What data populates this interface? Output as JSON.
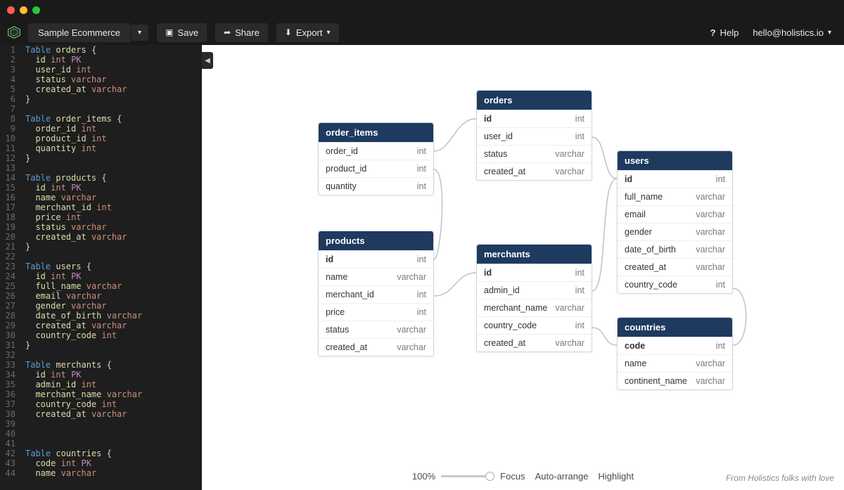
{
  "project": {
    "name": "Sample Ecommerce"
  },
  "toolbar": {
    "save": "Save",
    "share": "Share",
    "export": "Export",
    "help": "Help",
    "user": "hello@holistics.io"
  },
  "editor_lines": [
    {
      "n": 1,
      "tokens": [
        [
          "kw",
          "Table"
        ],
        [
          "sp",
          " "
        ],
        [
          "id",
          "orders"
        ],
        [
          "sp",
          " "
        ],
        [
          "br",
          "{"
        ]
      ]
    },
    {
      "n": 2,
      "tokens": [
        [
          "sp",
          "  "
        ],
        [
          "id",
          "id"
        ],
        [
          "sp",
          " "
        ],
        [
          "ty",
          "int"
        ],
        [
          "sp",
          " "
        ],
        [
          "pk",
          "PK"
        ]
      ]
    },
    {
      "n": 3,
      "tokens": [
        [
          "sp",
          "  "
        ],
        [
          "id",
          "user_id"
        ],
        [
          "sp",
          " "
        ],
        [
          "ty",
          "int"
        ]
      ]
    },
    {
      "n": 4,
      "tokens": [
        [
          "sp",
          "  "
        ],
        [
          "id",
          "status"
        ],
        [
          "sp",
          " "
        ],
        [
          "ty",
          "varchar"
        ]
      ]
    },
    {
      "n": 5,
      "tokens": [
        [
          "sp",
          "  "
        ],
        [
          "id",
          "created_at"
        ],
        [
          "sp",
          " "
        ],
        [
          "ty",
          "varchar"
        ]
      ]
    },
    {
      "n": 6,
      "tokens": [
        [
          "br",
          "}"
        ]
      ]
    },
    {
      "n": 7,
      "tokens": []
    },
    {
      "n": 8,
      "tokens": [
        [
          "kw",
          "Table"
        ],
        [
          "sp",
          " "
        ],
        [
          "id",
          "order_items"
        ],
        [
          "sp",
          " "
        ],
        [
          "br",
          "{"
        ]
      ]
    },
    {
      "n": 9,
      "tokens": [
        [
          "sp",
          "  "
        ],
        [
          "id",
          "order_id"
        ],
        [
          "sp",
          " "
        ],
        [
          "ty",
          "int"
        ]
      ]
    },
    {
      "n": 10,
      "tokens": [
        [
          "sp",
          "  "
        ],
        [
          "id",
          "product_id"
        ],
        [
          "sp",
          " "
        ],
        [
          "ty",
          "int"
        ]
      ]
    },
    {
      "n": 11,
      "tokens": [
        [
          "sp",
          "  "
        ],
        [
          "id",
          "quantity"
        ],
        [
          "sp",
          " "
        ],
        [
          "ty",
          "int"
        ]
      ]
    },
    {
      "n": 12,
      "tokens": [
        [
          "br",
          "}"
        ]
      ]
    },
    {
      "n": 13,
      "tokens": []
    },
    {
      "n": 14,
      "tokens": [
        [
          "kw",
          "Table"
        ],
        [
          "sp",
          " "
        ],
        [
          "id",
          "products"
        ],
        [
          "sp",
          " "
        ],
        [
          "br",
          "{"
        ]
      ]
    },
    {
      "n": 15,
      "tokens": [
        [
          "sp",
          "  "
        ],
        [
          "id",
          "id"
        ],
        [
          "sp",
          " "
        ],
        [
          "ty",
          "int"
        ],
        [
          "sp",
          " "
        ],
        [
          "pk",
          "PK"
        ]
      ]
    },
    {
      "n": 16,
      "tokens": [
        [
          "sp",
          "  "
        ],
        [
          "id",
          "name"
        ],
        [
          "sp",
          " "
        ],
        [
          "ty",
          "varchar"
        ]
      ]
    },
    {
      "n": 17,
      "tokens": [
        [
          "sp",
          "  "
        ],
        [
          "id",
          "merchant_id"
        ],
        [
          "sp",
          " "
        ],
        [
          "ty",
          "int"
        ]
      ]
    },
    {
      "n": 18,
      "tokens": [
        [
          "sp",
          "  "
        ],
        [
          "id",
          "price"
        ],
        [
          "sp",
          " "
        ],
        [
          "ty",
          "int"
        ]
      ]
    },
    {
      "n": 19,
      "tokens": [
        [
          "sp",
          "  "
        ],
        [
          "id",
          "status"
        ],
        [
          "sp",
          " "
        ],
        [
          "ty",
          "varchar"
        ]
      ]
    },
    {
      "n": 20,
      "tokens": [
        [
          "sp",
          "  "
        ],
        [
          "id",
          "created_at"
        ],
        [
          "sp",
          " "
        ],
        [
          "ty",
          "varchar"
        ]
      ]
    },
    {
      "n": 21,
      "tokens": [
        [
          "br",
          "}"
        ]
      ]
    },
    {
      "n": 22,
      "tokens": []
    },
    {
      "n": 23,
      "tokens": [
        [
          "kw",
          "Table"
        ],
        [
          "sp",
          " "
        ],
        [
          "id",
          "users"
        ],
        [
          "sp",
          " "
        ],
        [
          "br",
          "{"
        ]
      ]
    },
    {
      "n": 24,
      "tokens": [
        [
          "sp",
          "  "
        ],
        [
          "id",
          "id"
        ],
        [
          "sp",
          " "
        ],
        [
          "ty",
          "int"
        ],
        [
          "sp",
          " "
        ],
        [
          "pk",
          "PK"
        ]
      ]
    },
    {
      "n": 25,
      "tokens": [
        [
          "sp",
          "  "
        ],
        [
          "id",
          "full_name"
        ],
        [
          "sp",
          " "
        ],
        [
          "ty",
          "varchar"
        ]
      ]
    },
    {
      "n": 26,
      "tokens": [
        [
          "sp",
          "  "
        ],
        [
          "id",
          "email"
        ],
        [
          "sp",
          " "
        ],
        [
          "ty",
          "varchar"
        ]
      ]
    },
    {
      "n": 27,
      "tokens": [
        [
          "sp",
          "  "
        ],
        [
          "id",
          "gender"
        ],
        [
          "sp",
          " "
        ],
        [
          "ty",
          "varchar"
        ]
      ]
    },
    {
      "n": 28,
      "tokens": [
        [
          "sp",
          "  "
        ],
        [
          "id",
          "date_of_birth"
        ],
        [
          "sp",
          " "
        ],
        [
          "ty",
          "varchar"
        ]
      ]
    },
    {
      "n": 29,
      "tokens": [
        [
          "sp",
          "  "
        ],
        [
          "id",
          "created_at"
        ],
        [
          "sp",
          " "
        ],
        [
          "ty",
          "varchar"
        ]
      ]
    },
    {
      "n": 30,
      "tokens": [
        [
          "sp",
          "  "
        ],
        [
          "id",
          "country_code"
        ],
        [
          "sp",
          " "
        ],
        [
          "ty",
          "int"
        ]
      ]
    },
    {
      "n": 31,
      "tokens": [
        [
          "br",
          "}"
        ]
      ]
    },
    {
      "n": 32,
      "tokens": []
    },
    {
      "n": 33,
      "tokens": [
        [
          "kw",
          "Table"
        ],
        [
          "sp",
          " "
        ],
        [
          "id",
          "merchants"
        ],
        [
          "sp",
          " "
        ],
        [
          "br",
          "{"
        ]
      ]
    },
    {
      "n": 34,
      "tokens": [
        [
          "sp",
          "  "
        ],
        [
          "id",
          "id"
        ],
        [
          "sp",
          " "
        ],
        [
          "ty",
          "int"
        ],
        [
          "sp",
          " "
        ],
        [
          "pk",
          "PK"
        ]
      ]
    },
    {
      "n": 35,
      "tokens": [
        [
          "sp",
          "  "
        ],
        [
          "id",
          "admin_id"
        ],
        [
          "sp",
          " "
        ],
        [
          "ty",
          "int"
        ]
      ]
    },
    {
      "n": 36,
      "tokens": [
        [
          "sp",
          "  "
        ],
        [
          "id",
          "merchant_name"
        ],
        [
          "sp",
          " "
        ],
        [
          "ty",
          "varchar"
        ]
      ]
    },
    {
      "n": 37,
      "tokens": [
        [
          "sp",
          "  "
        ],
        [
          "id",
          "country_code"
        ],
        [
          "sp",
          " "
        ],
        [
          "ty",
          "int"
        ]
      ]
    },
    {
      "n": 38,
      "tokens": [
        [
          "sp",
          "  "
        ],
        [
          "id",
          "created_at"
        ],
        [
          "sp",
          " "
        ],
        [
          "ty",
          "varchar"
        ]
      ]
    },
    {
      "n": 39,
      "tokens": []
    },
    {
      "n": 40,
      "tokens": []
    },
    {
      "n": 41,
      "tokens": []
    },
    {
      "n": 42,
      "tokens": [
        [
          "kw",
          "Table"
        ],
        [
          "sp",
          " "
        ],
        [
          "id",
          "countries"
        ],
        [
          "sp",
          " "
        ],
        [
          "br",
          "{"
        ]
      ]
    },
    {
      "n": 43,
      "tokens": [
        [
          "sp",
          "  "
        ],
        [
          "id",
          "code"
        ],
        [
          "sp",
          " "
        ],
        [
          "ty",
          "int"
        ],
        [
          "sp",
          " "
        ],
        [
          "pk",
          "PK"
        ]
      ]
    },
    {
      "n": 44,
      "tokens": [
        [
          "sp",
          "  "
        ],
        [
          "id",
          "name"
        ],
        [
          "sp",
          " "
        ],
        [
          "ty",
          "varchar"
        ]
      ]
    }
  ],
  "tables": {
    "order_items": {
      "title": "order_items",
      "fields": [
        {
          "name": "order_id",
          "type": "int"
        },
        {
          "name": "product_id",
          "type": "int"
        },
        {
          "name": "quantity",
          "type": "int"
        }
      ]
    },
    "orders": {
      "title": "orders",
      "fields": [
        {
          "name": "id",
          "type": "int",
          "pk": true
        },
        {
          "name": "user_id",
          "type": "int"
        },
        {
          "name": "status",
          "type": "varchar"
        },
        {
          "name": "created_at",
          "type": "varchar"
        }
      ]
    },
    "products": {
      "title": "products",
      "fields": [
        {
          "name": "id",
          "type": "int",
          "pk": true
        },
        {
          "name": "name",
          "type": "varchar"
        },
        {
          "name": "merchant_id",
          "type": "int"
        },
        {
          "name": "price",
          "type": "int"
        },
        {
          "name": "status",
          "type": "varchar"
        },
        {
          "name": "created_at",
          "type": "varchar"
        }
      ]
    },
    "merchants": {
      "title": "merchants",
      "fields": [
        {
          "name": "id",
          "type": "int",
          "pk": true
        },
        {
          "name": "admin_id",
          "type": "int"
        },
        {
          "name": "merchant_name",
          "type": "varchar"
        },
        {
          "name": "country_code",
          "type": "int"
        },
        {
          "name": "created_at",
          "type": "varchar"
        }
      ]
    },
    "users": {
      "title": "users",
      "fields": [
        {
          "name": "id",
          "type": "int",
          "pk": true
        },
        {
          "name": "full_name",
          "type": "varchar"
        },
        {
          "name": "email",
          "type": "varchar"
        },
        {
          "name": "gender",
          "type": "varchar"
        },
        {
          "name": "date_of_birth",
          "type": "varchar"
        },
        {
          "name": "created_at",
          "type": "varchar"
        },
        {
          "name": "country_code",
          "type": "int"
        }
      ]
    },
    "countries": {
      "title": "countries",
      "fields": [
        {
          "name": "code",
          "type": "int",
          "pk": true
        },
        {
          "name": "name",
          "type": "varchar"
        },
        {
          "name": "continent_name",
          "type": "varchar"
        }
      ]
    }
  },
  "bottombar": {
    "zoom": "100%",
    "focus": "Focus",
    "auto_arrange": "Auto-arrange",
    "highlight": "Highlight"
  },
  "credit": "From Holistics folks with love"
}
